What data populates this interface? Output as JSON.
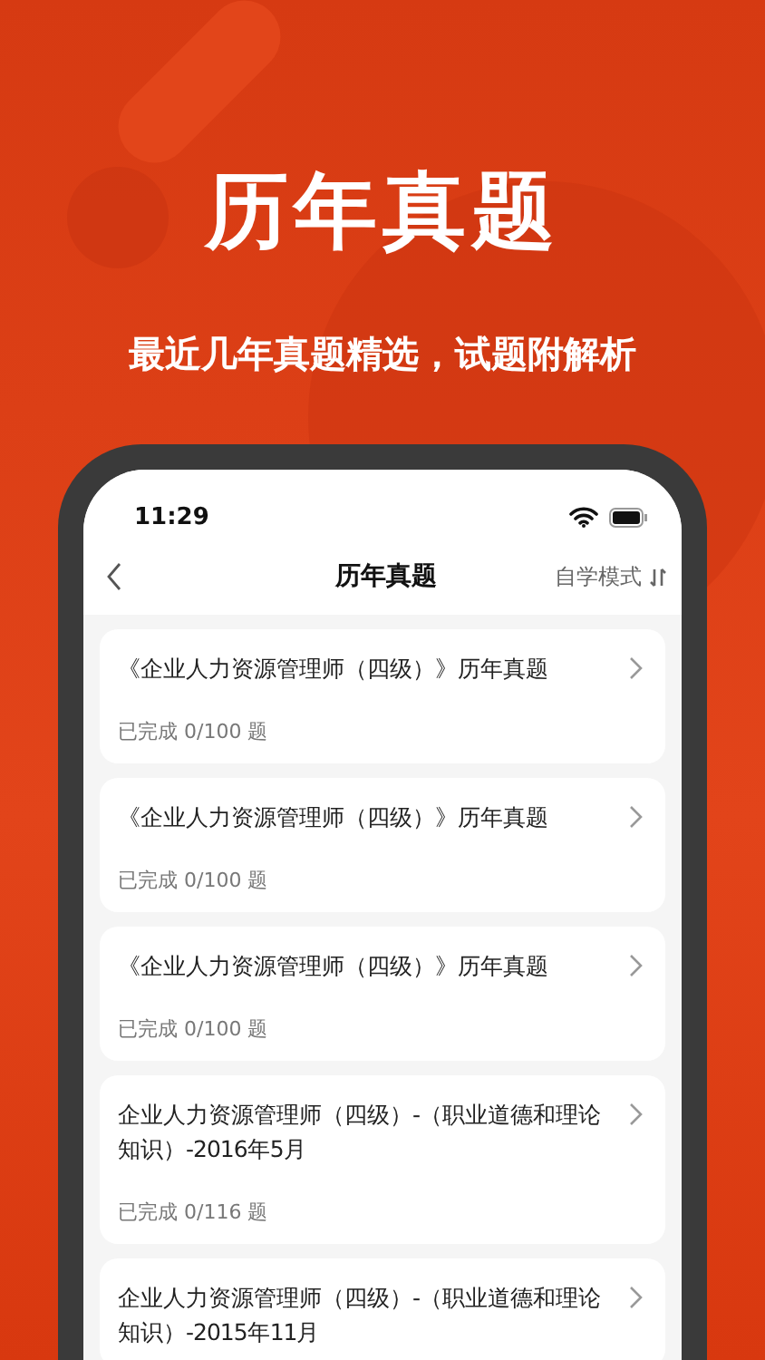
{
  "headline": "历年真题",
  "subtitle": "最近几年真题精选，试题附解析",
  "status_bar": {
    "time": "11:29"
  },
  "nav": {
    "title": "历年真题",
    "mode": "自学模式"
  },
  "items": [
    {
      "title": "《企业人力资源管理师（四级）》历年真题",
      "progress": "已完成 0/100 题"
    },
    {
      "title": "《企业人力资源管理师（四级）》历年真题",
      "progress": "已完成 0/100 题"
    },
    {
      "title": "《企业人力资源管理师（四级）》历年真题",
      "progress": "已完成 0/100 题"
    },
    {
      "title": "企业人力资源管理师（四级）-（职业道德和理论知识）-2016年5月",
      "progress": "已完成 0/116 题"
    },
    {
      "title": "企业人力资源管理师（四级）-（职业道德和理论知识）-2015年11月"
    }
  ]
}
